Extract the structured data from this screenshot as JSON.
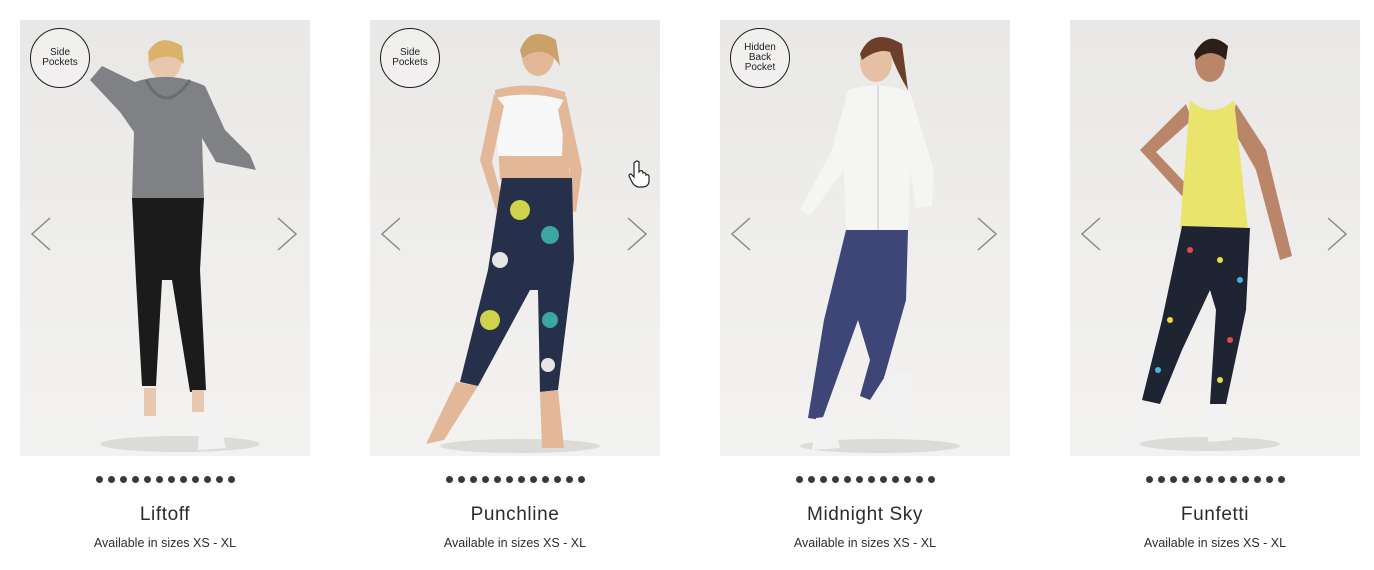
{
  "products": [
    {
      "badge": "Side\nPockets",
      "name": "Liftoff",
      "sizes": "Available in sizes XS - XL",
      "image_icon": "model-photo-icon",
      "colors": {
        "top": "#7f8185",
        "bottom": "#1b1b1b",
        "skin": "#e7c7ad",
        "hair": "#d9b36a",
        "shoe": "#f2f2f2"
      },
      "dots": 12
    },
    {
      "badge": "Side\nPockets",
      "name": "Punchline",
      "sizes": "Available in sizes XS - XL",
      "image_icon": "model-photo-icon",
      "colors": {
        "top": "#f7f7f7",
        "bottom": "#27304a",
        "skin": "#e3b898",
        "hair": "#caa267",
        "shoe": "#e3b898"
      },
      "dots": 12
    },
    {
      "badge": "Hidden\nBack\nPocket",
      "name": "Midnight Sky",
      "sizes": "Available in sizes XS - XL",
      "image_icon": "model-photo-icon",
      "colors": {
        "top": "#f5f5f3",
        "bottom": "#3d4677",
        "skin": "#e6c0a4",
        "hair": "#6b3f2a",
        "shoe": "#f2f2f2"
      },
      "dots": 12
    },
    {
      "badge": "",
      "name": "Funfetti",
      "sizes": "Available in sizes XS - XL",
      "image_icon": "model-photo-icon",
      "colors": {
        "top": "#eae46c",
        "bottom": "#1f2433",
        "skin": "#b9866a",
        "hair": "#2c1f17",
        "shoe": "#f2f2f2"
      },
      "dots": 12
    }
  ],
  "colors": {
    "text": "#2b2b2b",
    "dot": "#3a3a3a",
    "photo_bg": "#ecebe9"
  }
}
